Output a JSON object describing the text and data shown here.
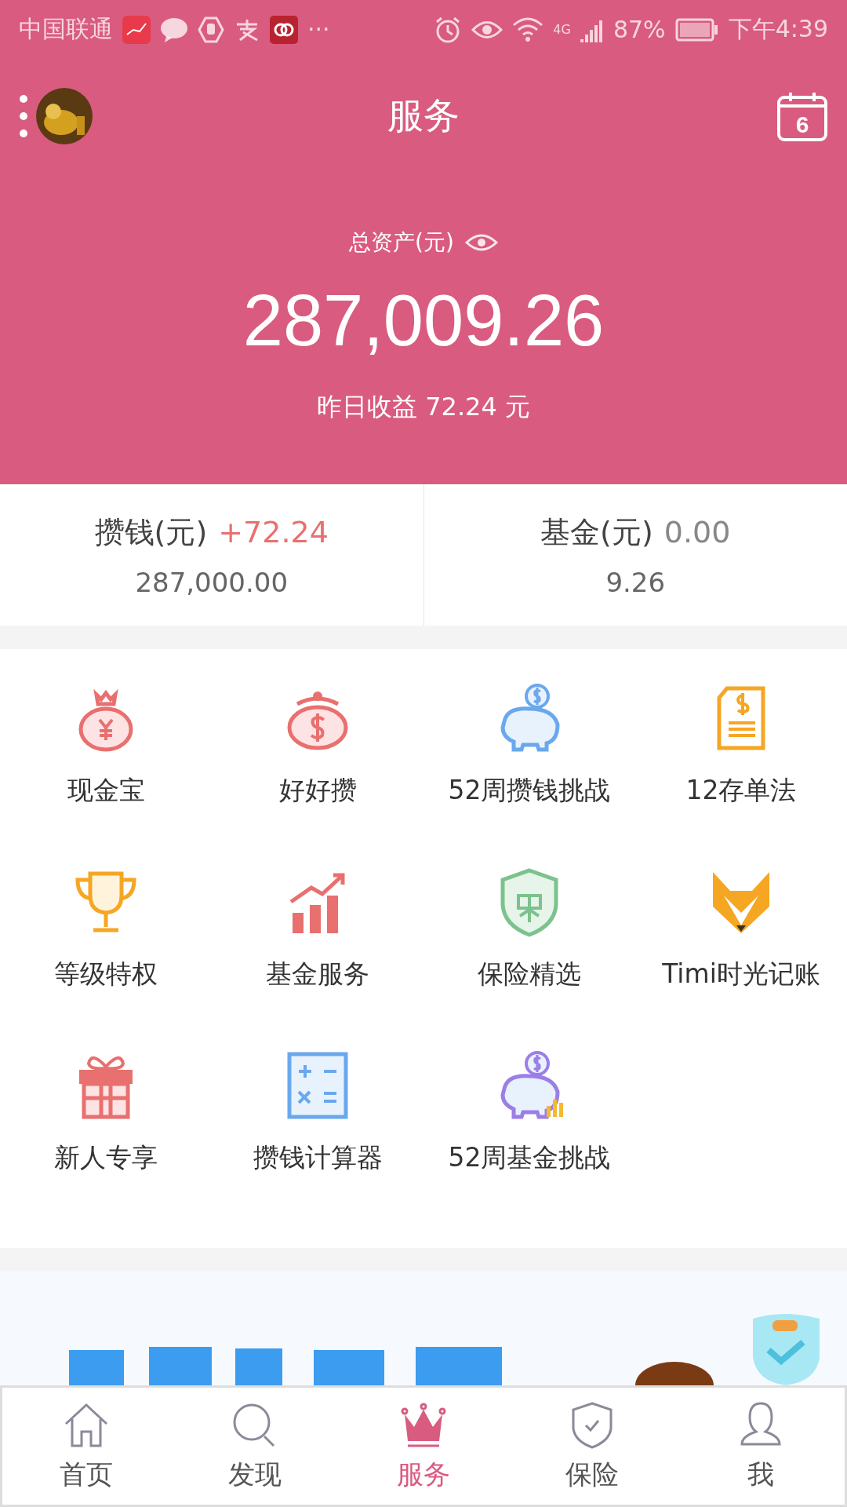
{
  "status_bar": {
    "carrier": "中国联通",
    "more": "···",
    "network": "4G",
    "battery": "87%",
    "time": "下午4:39"
  },
  "header": {
    "title": "服务",
    "calendar_day": "6"
  },
  "assets": {
    "label": "总资产(元)",
    "total": "287,009.26",
    "yesterday": "昨日收益 72.24 元"
  },
  "summary": [
    {
      "label": "攒钱(元)",
      "change": "+72.24",
      "positive": true,
      "amount": "287,000.00"
    },
    {
      "label": "基金(元)",
      "change": "0.00",
      "positive": false,
      "amount": "9.26"
    }
  ],
  "services": [
    {
      "label": "现金宝",
      "kind": "moneybag"
    },
    {
      "label": "好好攒",
      "kind": "purse"
    },
    {
      "label": "52周攒钱挑战",
      "kind": "piggy"
    },
    {
      "label": "12存单法",
      "kind": "document"
    },
    {
      "label": "等级特权",
      "kind": "trophy"
    },
    {
      "label": "基金服务",
      "kind": "chart"
    },
    {
      "label": "保险精选",
      "kind": "shield"
    },
    {
      "label": "Timi时光记账",
      "kind": "fox"
    },
    {
      "label": "新人专享",
      "kind": "gift"
    },
    {
      "label": "攒钱计算器",
      "kind": "calculator"
    },
    {
      "label": "52周基金挑战",
      "kind": "piggychart"
    }
  ],
  "nav": [
    {
      "label": "首页",
      "kind": "home",
      "selected": false
    },
    {
      "label": "发现",
      "kind": "search",
      "selected": false
    },
    {
      "label": "服务",
      "kind": "crown",
      "selected": true
    },
    {
      "label": "保险",
      "kind": "shield",
      "selected": false
    },
    {
      "label": "我",
      "kind": "person",
      "selected": false
    }
  ]
}
